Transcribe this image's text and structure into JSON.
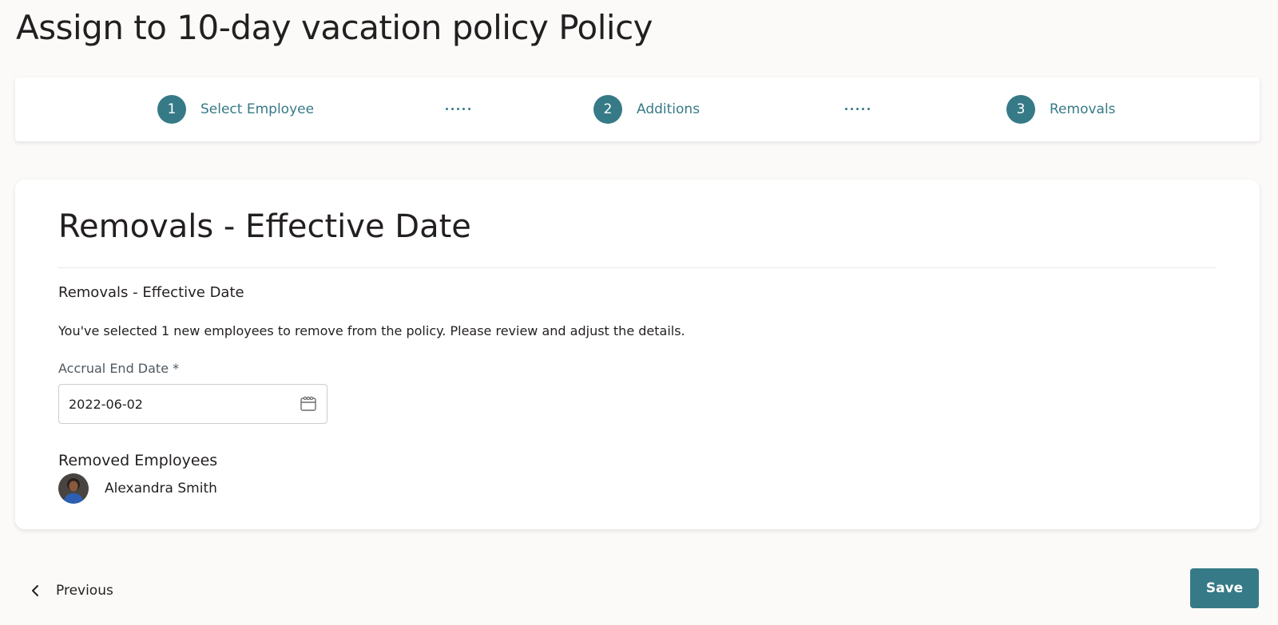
{
  "page": {
    "title": "Assign to 10-day vacation policy Policy"
  },
  "stepper": {
    "steps": [
      {
        "number": "1",
        "label": "Select Employee"
      },
      {
        "number": "2",
        "label": "Additions"
      },
      {
        "number": "3",
        "label": "Removals"
      }
    ]
  },
  "card": {
    "title": "Removals - Effective Date",
    "section_heading": "Removals - Effective Date",
    "description": "You've selected 1 new employees to remove from the policy. Please review and adjust the details.",
    "accrual_end_date": {
      "label": "Accrual End Date *",
      "value": "2022-06-02",
      "icon": "calendar-icon"
    },
    "removed_employees": {
      "heading": "Removed Employees",
      "items": [
        {
          "name": "Alexandra Smith"
        }
      ]
    }
  },
  "footer": {
    "previous_label": "Previous",
    "save_label": "Save"
  },
  "colors": {
    "accent": "#367a87",
    "background": "#fbfaf9",
    "text": "#231f20"
  }
}
